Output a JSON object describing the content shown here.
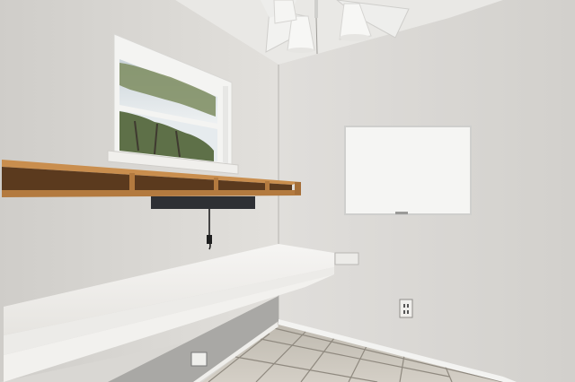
{
  "scene": {
    "colors": {
      "left_wall": "#dcdad6",
      "right_wall": "#d9d7d3",
      "ceiling": "#e8e7e4",
      "floor_tile": "#c9c4bb",
      "grout": "#8f897f",
      "shelf_wood": "#b37a3f",
      "shelf_dark": "#5b3a1e",
      "desk_top": "#f3f2ef",
      "whiteboard": "#f4f4f2",
      "baseboard": "#f2f2f0",
      "tree_green": "#5e7048",
      "sky": "#e7ecef"
    },
    "objects": [
      "ceiling-fan",
      "window",
      "wooden-shelf",
      "under-shelf-light",
      "built-in-desk",
      "whiteboard",
      "wall-outlet",
      "tile-floor"
    ]
  }
}
